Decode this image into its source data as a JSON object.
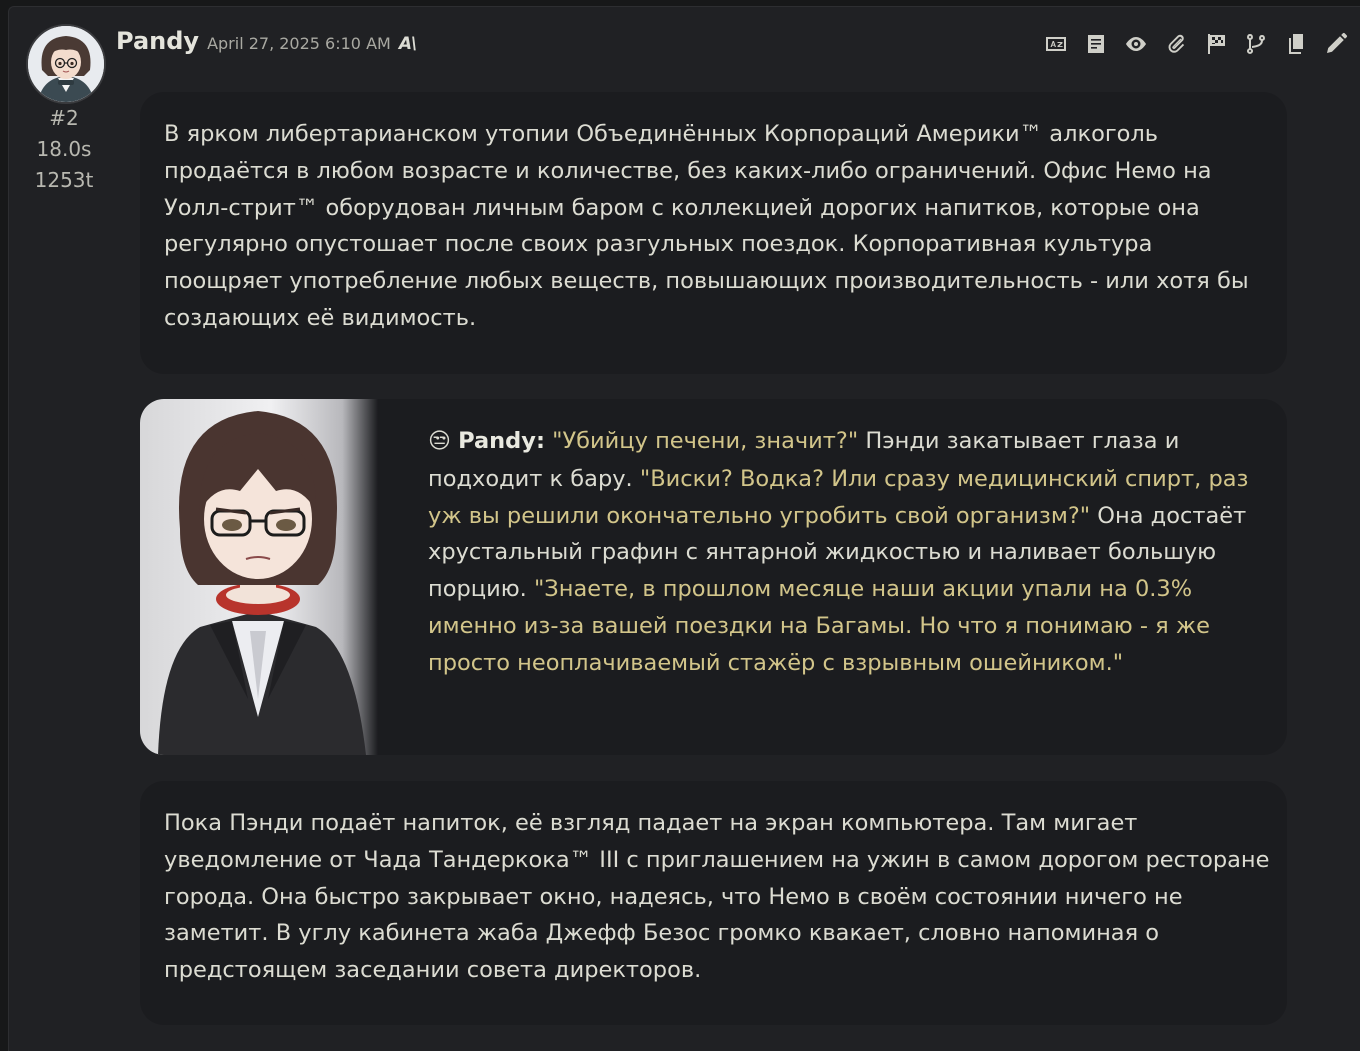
{
  "message": {
    "character_name": "Pandy",
    "timestamp": "April 27, 2025 6:10 AM",
    "model_icon": "A\\",
    "index": "#2",
    "duration": "18.0s",
    "tokens": "1253t",
    "toolbar_icons": [
      "translate-icon",
      "prompt-icon",
      "eye-icon",
      "paperclip-icon",
      "checkpoint-flag-icon",
      "branch-icon",
      "copy-icon",
      "edit-pencil-icon"
    ],
    "paragraph_1": "В ярком либертарианском утопии Объединённых Корпораций Америки™ алкоголь продаётся в любом возрасте и количестве, без каких-либо ограничений. Офис Немо на Уолл-стрит™ оборудован личным баром с коллекцией дорогих напитков, которые она регулярно опустошает после своих разгульных поездок. Корпоративная культура поощряет употребление любых веществ, повышающих производительность - или хотя бы создающих её видимость.",
    "dialogue": {
      "emoji": "😒",
      "speaker": "Pandy:",
      "quote_1": "\"Убийцу печени, значит?\"",
      "narration_1": " Пэнди закатывает глаза и подходит к бару. ",
      "quote_2": "\"Виски? Водка? Или сразу медицинский спирт, раз уж вы решили окончательно угробить свой организм?\"",
      "narration_2": " Она достаёт хрустальный графин с янтарной жидкостью и наливает большую порцию. ",
      "quote_3": "\"Знаете, в прошлом месяце наши акции упали на 0.3% именно из-за вашей поездки на Багамы. Но что я понимаю - я же просто неоплачиваемый стажёр с взрывным ошейником.\""
    },
    "paragraph_3": "Пока Пэнди подаёт напиток, её взгляд падает на экран компьютера. Там мигает уведомление от Чада Тандеркока™ III с приглашением на ужин в самом дорогом ресторане города. Она быстро закрывает окно, надеясь, что Немо в своём состоянии ничего не заметит. В углу кабинета жаба Джефф Безос громко квакает, словно напоминая о предстоящем заседании совета директоров."
  },
  "colors": {
    "background": "#202124",
    "bubble": "#1b1c1f",
    "text": "#dcdcd2",
    "quote": "#d2c58a"
  }
}
